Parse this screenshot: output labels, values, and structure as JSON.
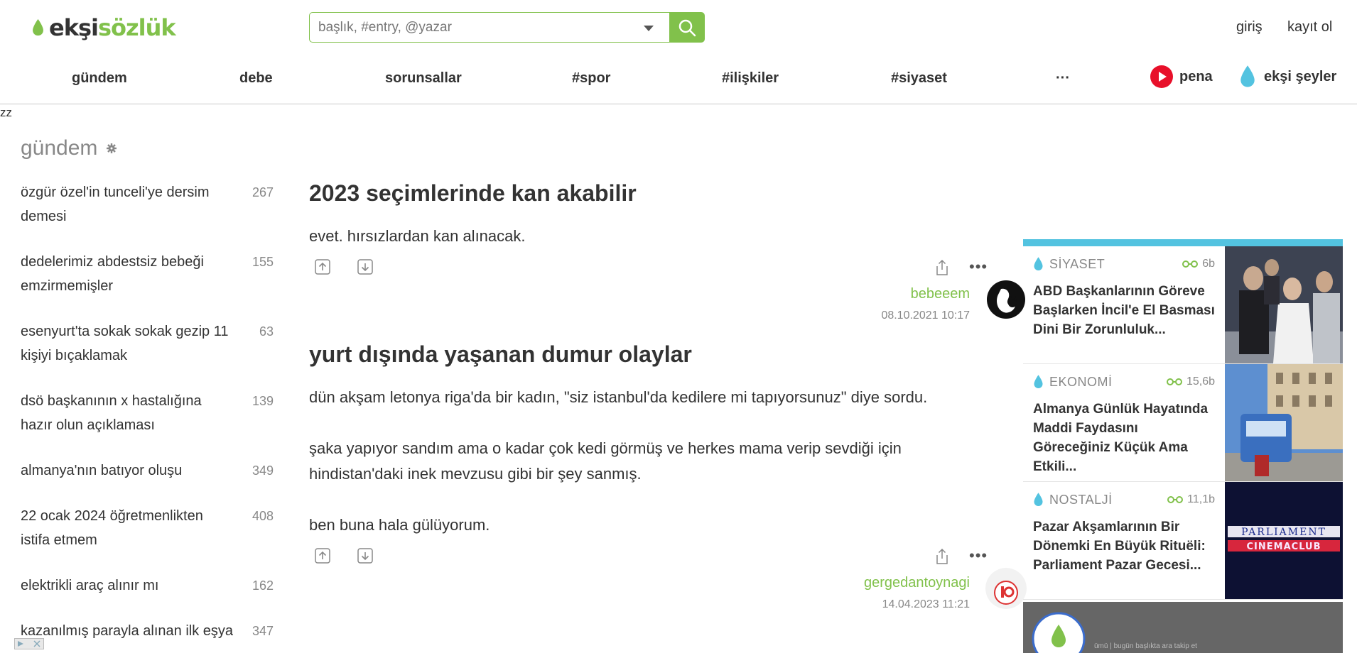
{
  "header": {
    "logo": {
      "part1": "ekşi",
      "part2": "sözlük"
    },
    "search": {
      "placeholder": "başlık, #entry, @yazar",
      "value": ""
    },
    "login": "giriş",
    "signup": "kayıt ol"
  },
  "nav": {
    "items": [
      "gündem",
      "debe",
      "sorunsallar",
      "#spor",
      "#ilişkiler",
      "#siyaset"
    ],
    "more": "···",
    "pena": "pena",
    "eksi_seyler": "ekşi şeyler"
  },
  "stray_text": "zz",
  "left": {
    "title": "gündem",
    "topics": [
      {
        "name": "özgür özel'in tunceli'ye dersim demesi",
        "count": "267"
      },
      {
        "name": "dedelerimiz abdestsiz bebeği emzirmemişler",
        "count": "155"
      },
      {
        "name": "esenyurt'ta sokak sokak gezip 11 kişiyi bıçaklamak",
        "count": "63"
      },
      {
        "name": "dsö başkanının x hastalığına hazır olun açıklaması",
        "count": "139"
      },
      {
        "name": "almanya'nın batıyor oluşu",
        "count": "349"
      },
      {
        "name": "22 ocak 2024 öğretmenlikten istifa etmem",
        "count": "408"
      },
      {
        "name": "elektrikli araç alınır mı",
        "count": "162"
      },
      {
        "name": "kazanılmış parayla alınan ilk eşya",
        "count": "347"
      }
    ]
  },
  "entries": [
    {
      "title": "2023 seçimlerinde kan akabilir",
      "paragraphs": [
        "evet. hırsızlardan kan alınacak."
      ],
      "author": "bebeeem",
      "date": "08.10.2021 10:17"
    },
    {
      "title": "yurt dışında yaşanan dumur olaylar",
      "paragraphs": [
        "dün akşam letonya riga'da bir kadın, \"siz istanbul'da kedilere mi tapıyorsunuz\" diye sordu.",
        "şaka yapıyor sandım ama o kadar çok kedi görmüş ve herkes mama verip sevdiği için hindistan'daki inek mevzusu gibi bir şey sanmış.",
        "ben buna hala gülüyorum."
      ],
      "author": "gergedantoynagi",
      "date": "14.04.2023 11:21"
    }
  ],
  "sidebar": {
    "cards": [
      {
        "category": "SİYASET",
        "views": "6b",
        "title": "ABD Başkanlarının Göreve Başlarken İncil'e El Basması Dini Bir Zorunluluk..."
      },
      {
        "category": "EKONOMİ",
        "views": "15,6b",
        "title": "Almanya Günlük Hayatında Maddi Faydasını Göreceğiniz Küçük Ama Etkili..."
      },
      {
        "category": "NOSTALJİ",
        "views": "11,1b",
        "title": "Pazar Akşamlarının Bir Dönemki En Büyük Rituëli: Parliament Pazar Gecesi..."
      }
    ],
    "poster_text": {
      "line1": "PARLIAMENT",
      "line2": "CINEMACLUB"
    },
    "promo_text": "ümü | bugün     başlıkta ara     takip et"
  },
  "colors": {
    "brand_green": "#81c14b",
    "accent_blue": "#53c3e0",
    "pena_red": "#e8102a",
    "text": "#333333",
    "muted": "#888888"
  },
  "icons": [
    "logo-drop-icon",
    "search-icon",
    "caret-down-icon",
    "pena-icon",
    "drop-icon",
    "gear-icon",
    "upvote-icon",
    "downvote-icon",
    "share-icon",
    "more-icon",
    "eye-icon"
  ]
}
